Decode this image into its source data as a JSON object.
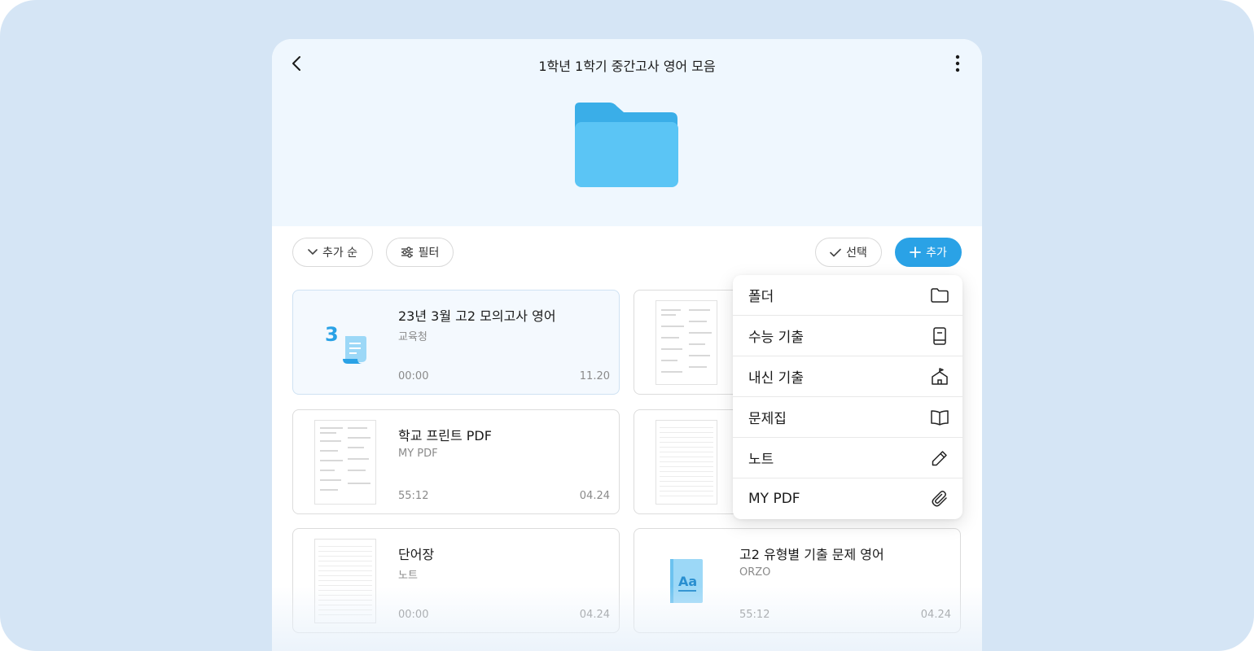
{
  "header": {
    "title": "1학년 1학기 중간고사 영어 모음"
  },
  "toolbar": {
    "sort_label": "추가 순",
    "filter_label": "필터",
    "select_label": "선택",
    "add_label": "추가"
  },
  "cards": [
    {
      "title": "23년 3월 고2 모의고사 영어",
      "subtitle": "교육청",
      "time": "00:00",
      "date": "11.20",
      "thumb_number": "3"
    },
    {
      "title": "",
      "subtitle": "",
      "time": "",
      "date": ""
    },
    {
      "title": "학교 프린트 PDF",
      "subtitle": "MY PDF",
      "time": "55:12",
      "date": "04.24"
    },
    {
      "title": "",
      "subtitle": "",
      "time": "",
      "date": ""
    },
    {
      "title": "단어장",
      "subtitle": "노트",
      "time": "00:00",
      "date": "04.24"
    },
    {
      "title": "고2 유형별 기출 문제 영어",
      "subtitle": "ORZO",
      "time": "55:12",
      "date": "04.24",
      "thumb_text": "Aa"
    }
  ],
  "add_menu": {
    "items": [
      {
        "label": "폴더",
        "icon": "folder-icon"
      },
      {
        "label": "수능 기출",
        "icon": "book-icon"
      },
      {
        "label": "내신 기출",
        "icon": "school-icon"
      },
      {
        "label": "문제집",
        "icon": "open-book-icon"
      },
      {
        "label": "노트",
        "icon": "pencil-icon"
      },
      {
        "label": "MY PDF",
        "icon": "paperclip-icon"
      }
    ]
  },
  "colors": {
    "accent": "#2aa2e6",
    "folder": "#5bc5f5",
    "folder_tab": "#3aaee8",
    "header_bg": "#eff7fe",
    "backdrop": "#d5e5f5"
  }
}
